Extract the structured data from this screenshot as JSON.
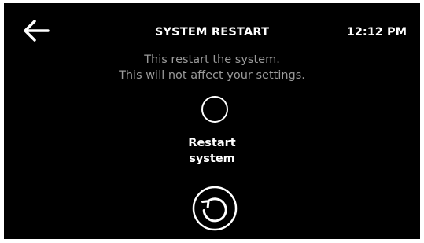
{
  "header": {
    "back_icon": "arrow-left-icon",
    "title": "SYSTEM RESTART",
    "time": "12:12 PM"
  },
  "message": {
    "line1": "This restart the system.",
    "line2": "This will not affect your settings."
  },
  "option": {
    "selected": false,
    "label_line1": "Restart",
    "label_line2": "system"
  },
  "action": {
    "icon": "restart-icon"
  },
  "colors": {
    "background": "#000000",
    "text": "#ffffff",
    "muted_text": "#9a9a9a"
  }
}
